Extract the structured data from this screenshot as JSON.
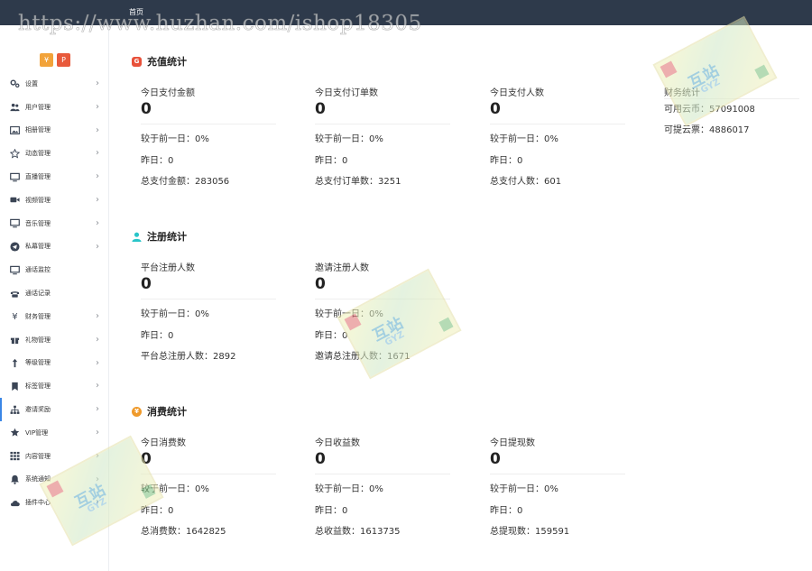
{
  "watermark": {
    "url": "https://www.huzhan.com/ishop18305",
    "logo_text": "互站",
    "logo_sub": "GYZ"
  },
  "topbar": {
    "breadcrumb": "首页"
  },
  "sidebar": {
    "logo_a": "¥",
    "logo_b": "P",
    "items": [
      {
        "label": "设置",
        "icon": "gears-icon"
      },
      {
        "label": "用户管理",
        "icon": "users-icon"
      },
      {
        "label": "相册管理",
        "icon": "image-icon"
      },
      {
        "label": "动态管理",
        "icon": "star-outline-icon"
      },
      {
        "label": "直播管理",
        "icon": "monitor-icon"
      },
      {
        "label": "视频管理",
        "icon": "video-camera-icon"
      },
      {
        "label": "音乐管理",
        "icon": "monitor-icon"
      },
      {
        "label": "私幕管理",
        "icon": "telegram-icon"
      },
      {
        "label": "通话监控",
        "icon": "monitor-icon"
      },
      {
        "label": "通话记录",
        "icon": "phone-icon"
      },
      {
        "label": "财务管理",
        "icon": "yen-icon"
      },
      {
        "label": "礼物管理",
        "icon": "gift-icon"
      },
      {
        "label": "等级管理",
        "icon": "level-arrow-icon"
      },
      {
        "label": "标签管理",
        "icon": "bookmark-icon"
      },
      {
        "label": "邀请奖励",
        "icon": "sitemap-icon"
      },
      {
        "label": "VIP管理",
        "icon": "star-icon"
      },
      {
        "label": "内容管理",
        "icon": "grid-icon"
      },
      {
        "label": "系统通知",
        "icon": "bell-icon"
      },
      {
        "label": "插件中心",
        "icon": "cloud-icon"
      }
    ],
    "active_index": 14
  },
  "sections": {
    "recharge": {
      "title": "充值统计",
      "icon": "g-badge-icon",
      "color": "#e8513a",
      "icon_text": "G",
      "stats": [
        {
          "title": "今日支付金额",
          "value": "0",
          "compare": "较于前一日：0%",
          "yesterday": "昨日：0",
          "total": "总支付金额：283056"
        },
        {
          "title": "今日支付订单数",
          "value": "0",
          "compare": "较于前一日：0%",
          "yesterday": "昨日：0",
          "total": "总支付订单数：3251"
        },
        {
          "title": "今日支付人数",
          "value": "0",
          "compare": "较于前一日：0%",
          "yesterday": "昨日：0",
          "total": "总支付人数：601"
        }
      ],
      "finance": {
        "title": "财务统计",
        "coins": "可用云币：57091008",
        "tickets": "可提云票：4886017"
      }
    },
    "register": {
      "title": "注册统计",
      "icon": "user-icon",
      "color": "#29c5c9",
      "stats": [
        {
          "title": "平台注册人数",
          "value": "0",
          "compare": "较于前一日：0%",
          "yesterday": "昨日：0",
          "total": "平台总注册人数：2892"
        },
        {
          "title": "邀请注册人数",
          "value": "0",
          "compare": "较于前一日：0%",
          "yesterday": "昨日：0",
          "total": "邀请总注册人数：1671"
        }
      ]
    },
    "consume": {
      "title": "消费统计",
      "icon": "yen-circle-icon",
      "color": "#ef9a2b",
      "icon_text": "¥",
      "stats": [
        {
          "title": "今日消费数",
          "value": "0",
          "compare": "较于前一日：0%",
          "yesterday": "昨日：0",
          "total": "总消费数：1642825"
        },
        {
          "title": "今日收益数",
          "value": "0",
          "compare": "较于前一日：0%",
          "yesterday": "昨日：0",
          "total": "总收益数：1613735"
        },
        {
          "title": "今日提现数",
          "value": "0",
          "compare": "较于前一日：0%",
          "yesterday": "昨日：0",
          "total": "总提现数：159591"
        }
      ]
    }
  }
}
